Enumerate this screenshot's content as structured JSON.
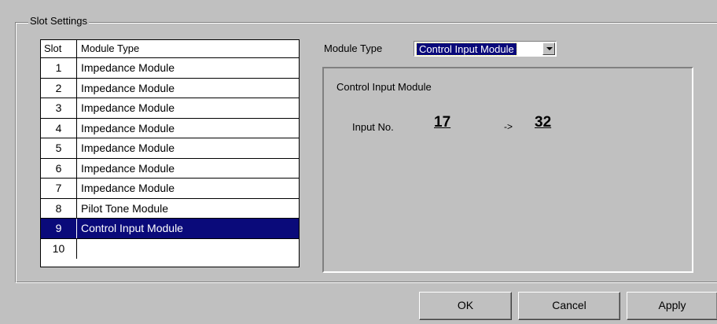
{
  "group_title": "Slot Settings",
  "table": {
    "headers": [
      "Slot",
      "Module Type"
    ],
    "rows": [
      {
        "slot": "1",
        "type": "Impedance Module"
      },
      {
        "slot": "2",
        "type": "Impedance Module"
      },
      {
        "slot": "3",
        "type": "Impedance Module"
      },
      {
        "slot": "4",
        "type": "Impedance Module"
      },
      {
        "slot": "5",
        "type": "Impedance Module"
      },
      {
        "slot": "6",
        "type": "Impedance Module"
      },
      {
        "slot": "7",
        "type": "Impedance Module"
      },
      {
        "slot": "8",
        "type": "Pilot Tone Module"
      },
      {
        "slot": "9",
        "type": "Control Input Module"
      },
      {
        "slot": "10",
        "type": ""
      }
    ],
    "selected_slot": "9"
  },
  "module_type": {
    "label": "Module Type",
    "selected": "Control Input Module"
  },
  "panel": {
    "title": "Control Input Module",
    "input_label": "Input No.",
    "input_from": "17",
    "arrow": "->",
    "input_to": "32"
  },
  "buttons": {
    "ok": "OK",
    "cancel": "Cancel",
    "apply": "Apply"
  },
  "colors": {
    "background": "#c0c0c0",
    "selection": "#0a0a7a"
  }
}
